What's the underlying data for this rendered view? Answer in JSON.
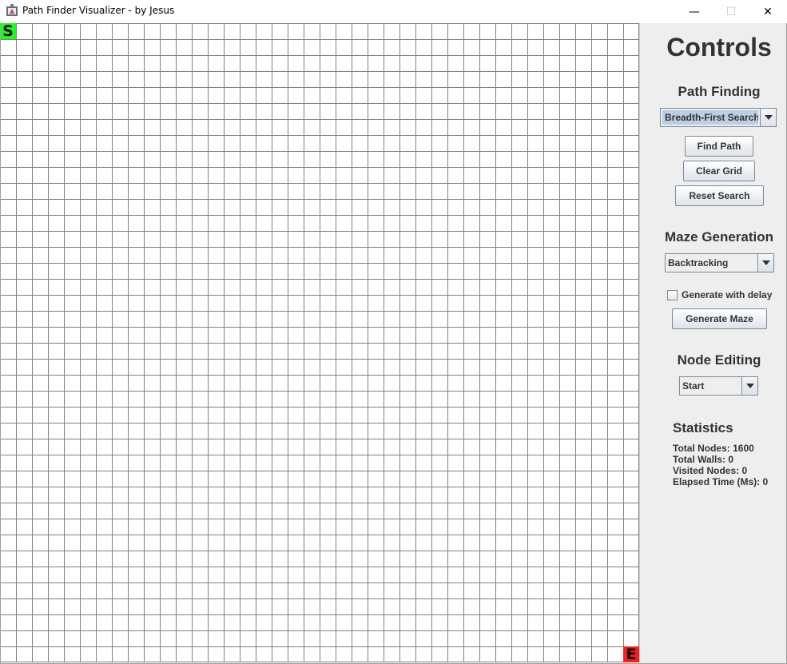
{
  "window": {
    "title": "Path Finder Visualizer - by Jesus",
    "minimize": "—",
    "maximize": "☐",
    "close": "✕"
  },
  "grid": {
    "rows": 40,
    "cols": 40,
    "start_label": "S",
    "end_label": "E",
    "start_color": "#1aff1a",
    "end_color": "#ff1a1a",
    "line_color": "#808080"
  },
  "controls": {
    "title": "Controls",
    "path_finding": {
      "title": "Path Finding",
      "algorithm": "Breadth-First Search",
      "find_path": "Find Path",
      "clear_grid": "Clear Grid",
      "reset_search": "Reset Search"
    },
    "maze_generation": {
      "title": "Maze Generation",
      "algorithm": "Backtracking",
      "delay_checkbox": "Generate with delay",
      "delay_checked": false,
      "generate": "Generate Maze"
    },
    "node_editing": {
      "title": "Node Editing",
      "mode": "Start"
    },
    "statistics": {
      "title": "Statistics",
      "total_nodes": "Total Nodes: 1600",
      "total_walls": "Total Walls: 0",
      "visited_nodes": "Visited Nodes: 0",
      "elapsed_time": "Elapsed Time (Ms): 0"
    }
  }
}
